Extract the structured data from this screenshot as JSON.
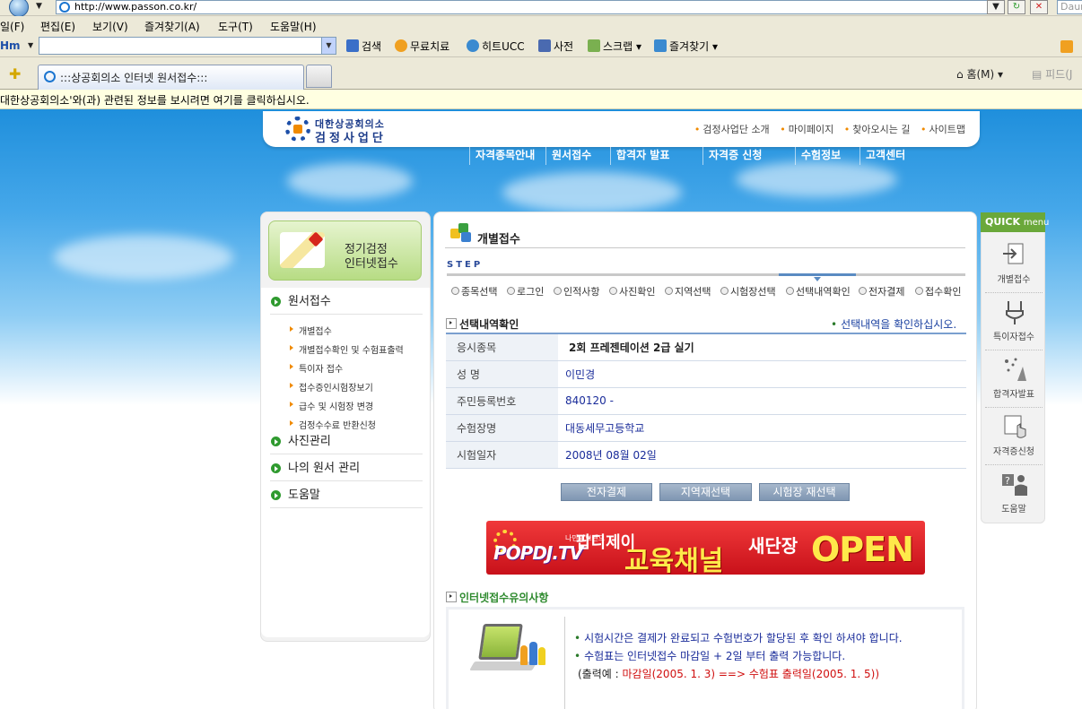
{
  "browser": {
    "address": "http://www.passon.co.kr/",
    "search_placeholder": "Daum",
    "menu": [
      "일(F)",
      "편집(E)",
      "보기(V)",
      "즐겨찾기(A)",
      "도구(T)",
      "도움말(H)"
    ],
    "toolbar_brand": "Hm",
    "toolbar_items": [
      "검색",
      "무료치료",
      "히트UCC",
      "사전",
      "스크랩",
      "즐겨찾기"
    ],
    "tab_title": ":::상공회의소 인터넷 원서접수:::",
    "home_label": "홈(M)",
    "feed_label": "피드(J",
    "info_bar": "대한상공회의소'와(과) 관련된 정보를 보시려면 여기를 클릭하십시오."
  },
  "site": {
    "logo_top": "대한상공회의소",
    "logo_bottom": "검정사업단",
    "top_links": [
      "검정사업단 소개",
      "마이페이지",
      "찾아오시는 길",
      "사이트맵"
    ],
    "gnb": [
      "자격종목안내",
      "원서접수",
      "합격자 발표",
      "자격증 신청",
      "수험정보",
      "고객센터"
    ]
  },
  "lnb": {
    "banner_line1": "정기검정",
    "banner_line2": "인터넷접수",
    "main_items": [
      "원서접수",
      "사진관리",
      "나의 원서 관리",
      "도움말"
    ],
    "sub_items": [
      "개별접수",
      "개별접수확인 및 수험표출력",
      "특이자 접수",
      "접수증인시험장보기",
      "급수 및 시험장 변경",
      "검정수수료 반환신청"
    ]
  },
  "content": {
    "title": "개별접수",
    "step_label": "STEP",
    "steps": [
      "종목선택",
      "로그인",
      "인적사항",
      "사진확인",
      "지역선택",
      "시험장선택",
      "선택내역확인",
      "전자결제",
      "접수확인"
    ],
    "section_title": "선택내역확인",
    "section_note": "선택내역을 확인하십시오.",
    "rows": [
      {
        "label": "응시종목",
        "value": "2회 프레젠테이션 2급 실기"
      },
      {
        "label": "성 명",
        "value": "이민경"
      },
      {
        "label": "주민등록번호",
        "value": "840120 -"
      },
      {
        "label": "수험장명",
        "value": "대동세무고등학교"
      },
      {
        "label": "시험일자",
        "value": "2008년 08월 02일"
      }
    ],
    "buttons": [
      "전자결제",
      "지역재선택",
      "시험장 재선택"
    ],
    "ad": {
      "brand": "POPDJ.TV",
      "small": "나만의브랜드",
      "name": "팝디제이",
      "channel": "교육채널",
      "new": "새단장",
      "open": "OPEN"
    },
    "notice_title": "인터넷접수유의사항",
    "notice_lines": [
      "시험시간은 결제가 완료되고 수험번호가 할당된 후 확인 하셔야 합니다.",
      "수험표는 인터넷접수 마감일 + 2일 부터 출력 가능합니다."
    ],
    "notice_example_prefix": "(출력예 :",
    "notice_example_red": "마감일(2005. 1. 3) ==> 수험표 출력일(2005. 1. 5))"
  },
  "quick": {
    "head": "QUICK",
    "head_sub": "menu",
    "items": [
      "개별접수",
      "특이자접수",
      "합격자발표",
      "자격증신청",
      "도움말"
    ]
  },
  "colors": {
    "sky": "#1f8fdc",
    "accent_green": "#6aa83a",
    "link_blue": "#1a2c9a",
    "alert_red": "#d01010"
  }
}
